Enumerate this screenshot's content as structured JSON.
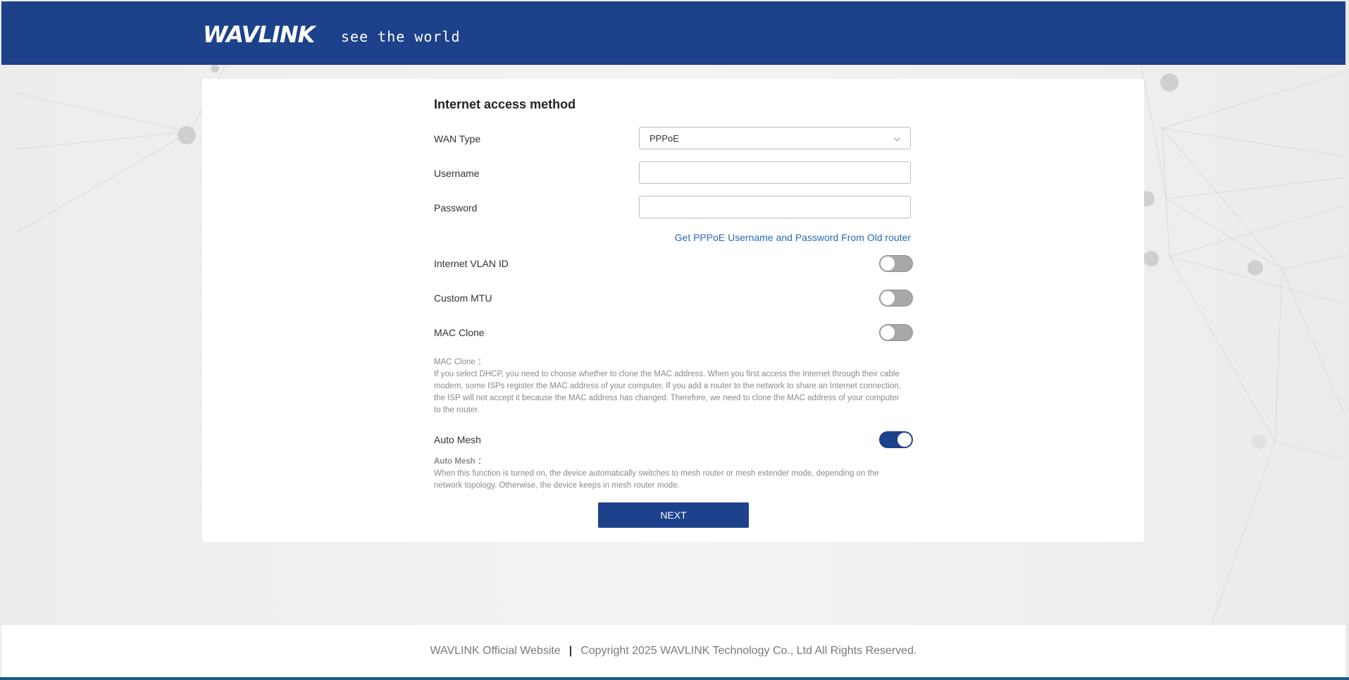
{
  "header": {
    "logo": "WAVLINK",
    "tagline": "see the world"
  },
  "form": {
    "title": "Internet access method",
    "wan_type": {
      "label": "WAN Type",
      "value": "PPPoE"
    },
    "username": {
      "label": "Username",
      "value": ""
    },
    "password": {
      "label": "Password",
      "value": ""
    },
    "get_link": "Get PPPoE Username and Password From Old router",
    "vlan": {
      "label": "Internet VLAN ID"
    },
    "mtu": {
      "label": "Custom MTU"
    },
    "mac_clone": {
      "label": "MAC Clone"
    },
    "mac_note": {
      "heading": "MAC Clone ：",
      "text": "If you select DHCP, you need to choose whether to clone the MAC address. When you first access the Internet through their cable modem, some ISPs register the MAC address of your computer. If you add a router to the network to share an Internet connection, the ISP will not accept it because the MAC address has changed. Therefore, we need to clone the MAC address of your computer to the router."
    },
    "auto_mesh": {
      "label": "Auto Mesh"
    },
    "mesh_note": {
      "heading": "Auto Mesh ：",
      "text": "When this function is turned on, the device automatically switches to mesh router or mesh extender mode, depending on the network topology. Otherwise, the device keeps in mesh router mode."
    },
    "next_label": "NEXT"
  },
  "toggles": {
    "vlan": false,
    "mtu": false,
    "mac_clone": false,
    "auto_mesh": true
  },
  "footer": {
    "website": "WAVLINK Official Website",
    "separator": "|",
    "copyright": "Copyright 2025 WAVLINK Technology Co., Ltd All Rights Reserved."
  },
  "colors": {
    "brand": "#1d418b",
    "link": "#2a6ab8"
  }
}
